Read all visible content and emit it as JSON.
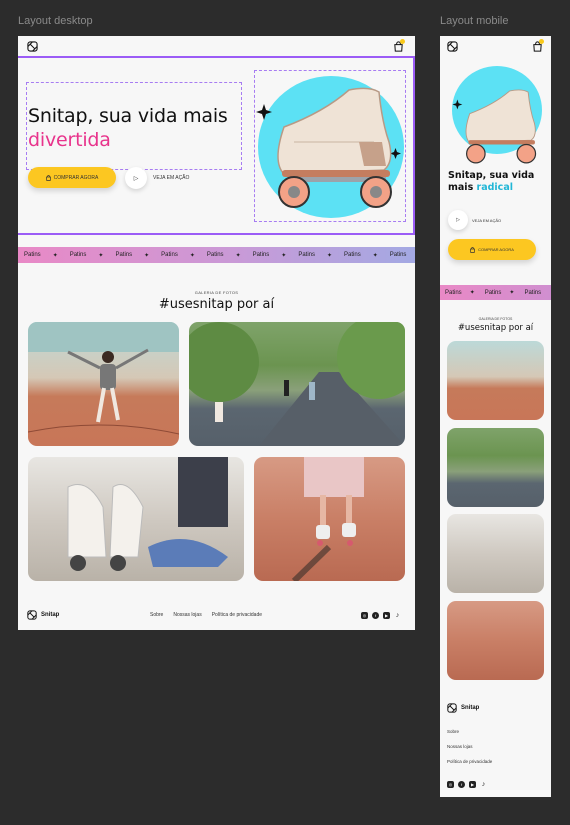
{
  "frames": {
    "desktop_label": "Layout desktop",
    "mobile_label": "Layout mobile"
  },
  "header": {
    "logo_icon": "snitap-logo-icon",
    "bag_icon": "shopping-bag-icon",
    "bag_badge_color": "#f9c91b"
  },
  "hero": {
    "title_plain": "Snitap, sua vida mais ",
    "title_accent": "divertida",
    "accent_color": "#e8348c",
    "buy_label": "COMPRAR AGORA",
    "play_label": "VEJA EM AÇÃO",
    "product_bg_color": "#5ce1f4"
  },
  "mobile_hero": {
    "title_plain": "Snitap, sua vida mais ",
    "title_accent": "radical",
    "accent_color": "#21b6d6",
    "play_label": "VEJA EM AÇÃO",
    "buy_label": "COMPRAR AGORA"
  },
  "marquee": {
    "items": [
      "Patins",
      "Patins",
      "Patins",
      "Patins",
      "Patins",
      "Patins",
      "Patins",
      "Patins",
      "Patins"
    ],
    "separator_icon": "sparkle-icon"
  },
  "gallery": {
    "eyebrow": "GALERIA DE FOTOS",
    "title": "#usesnitap por aí",
    "photos": [
      {
        "name": "photo-skater-pose"
      },
      {
        "name": "photo-skaters-park"
      },
      {
        "name": "photo-lacing-skates"
      },
      {
        "name": "photo-skater-feet"
      }
    ]
  },
  "footer": {
    "brand": "Snitap",
    "links": [
      "Sobre",
      "Nossas lojas",
      "Política de privacidade"
    ],
    "social_icons": [
      "instagram-icon",
      "facebook-icon",
      "youtube-icon",
      "tiktok-icon"
    ]
  }
}
